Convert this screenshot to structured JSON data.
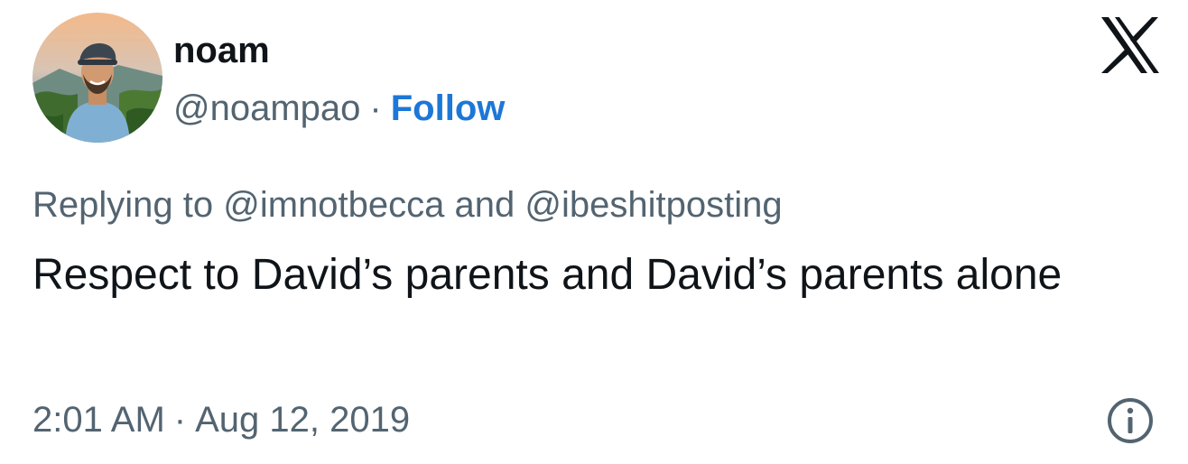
{
  "author": {
    "display_name": "noam",
    "handle": "@noampao",
    "separator": "·",
    "follow_label": "Follow"
  },
  "reply": {
    "prefix": "Replying to",
    "mentions": [
      "@imnotbecca",
      "@ibeshitposting"
    ],
    "conjunction": "and"
  },
  "tweet": {
    "text": "Respect to David’s parents and David’s parents alone"
  },
  "meta": {
    "time": "2:01 AM",
    "separator": "·",
    "date": "Aug 12, 2019"
  },
  "icons": {
    "brand": "x-logo-icon",
    "info": "info-icon"
  },
  "colors": {
    "text_primary": "#0f1419",
    "text_secondary": "#536471",
    "link": "#1d77d6"
  }
}
